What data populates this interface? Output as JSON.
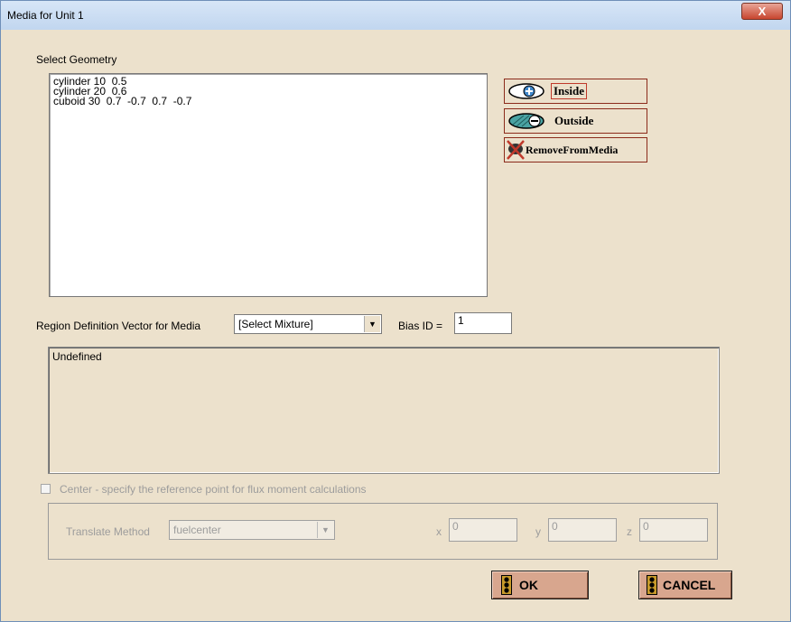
{
  "window": {
    "title": "Media for Unit 1",
    "close_glyph": "X"
  },
  "geometry": {
    "label": "Select Geometry",
    "items": [
      "cylinder 10  0.5",
      "cylinder 20  0.6",
      "cuboid 30  0.7  -0.7  0.7  -0.7"
    ]
  },
  "side_buttons": {
    "inside": "Inside",
    "outside": "Outside",
    "remove": "RemoveFromMedia"
  },
  "region": {
    "label": "Region Definition Vector for Media",
    "mixture_selected": "[Select Mixture]",
    "bias_label": "Bias ID =",
    "bias_value": "1",
    "text": "Undefined"
  },
  "center": {
    "label": "Center - specify the reference point for flux moment calculations",
    "checked": false,
    "translate_label": "Translate Method",
    "translate_value": "fuelcenter",
    "x_label": "x",
    "x_value": "0",
    "y_label": "y",
    "y_value": "0",
    "z_label": "z",
    "z_value": "0"
  },
  "actions": {
    "ok": "OK",
    "cancel": "CANCEL"
  },
  "colors": {
    "button_face": "#d8a68e",
    "button_border": "#8b2a1a",
    "dialog_bg": "#ece1cc",
    "traffic_light": "#c89b2a"
  }
}
